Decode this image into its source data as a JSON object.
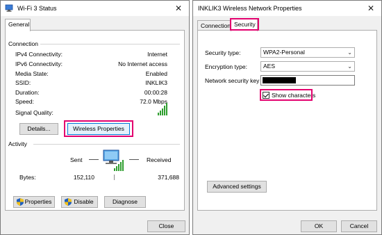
{
  "status_window": {
    "title": "Wi-Fi 3 Status",
    "close_glyph": "✕",
    "tab_general": "General",
    "connection": {
      "heading": "Connection",
      "rows": [
        {
          "label": "IPv4 Connectivity:",
          "value": "Internet"
        },
        {
          "label": "IPv6 Connectivity:",
          "value": "No Internet access"
        },
        {
          "label": "Media State:",
          "value": "Enabled"
        },
        {
          "label": "SSID:",
          "value": "INKLIK3"
        },
        {
          "label": "Duration:",
          "value": "00:00:28"
        },
        {
          "label": "Speed:",
          "value": "72.0 Mbps"
        }
      ],
      "signal_label": "Signal Quality:",
      "signal_bars": 5
    },
    "details_button": "Details...",
    "wireless_properties_button": "Wireless Properties",
    "activity": {
      "heading": "Activity",
      "sent_label": "Sent",
      "received_label": "Received",
      "bytes_label": "Bytes:",
      "bytes_sent": "152,110",
      "bytes_received": "371,688"
    },
    "properties_button": "Properties",
    "disable_button": "Disable",
    "diagnose_button": "Diagnose",
    "close_button": "Close"
  },
  "props_window": {
    "title": "INKLIK3 Wireless Network Properties",
    "close_glyph": "✕",
    "tab_connection": "Connection",
    "tab_security": "Security",
    "security_type_label": "Security type:",
    "security_type_value": "WPA2-Personal",
    "encryption_type_label": "Encryption type:",
    "encryption_type_value": "AES",
    "network_key_label": "Network security key",
    "show_characters_label": "Show characters",
    "show_characters_checked": true,
    "advanced_settings_button": "Advanced settings",
    "ok_button": "OK",
    "cancel_button": "Cancel"
  },
  "colors": {
    "highlight": "#e3006e",
    "signal_green": "#2e9e2e",
    "shield_blue": "#1f5fbf",
    "shield_yellow": "#f2c21b"
  }
}
